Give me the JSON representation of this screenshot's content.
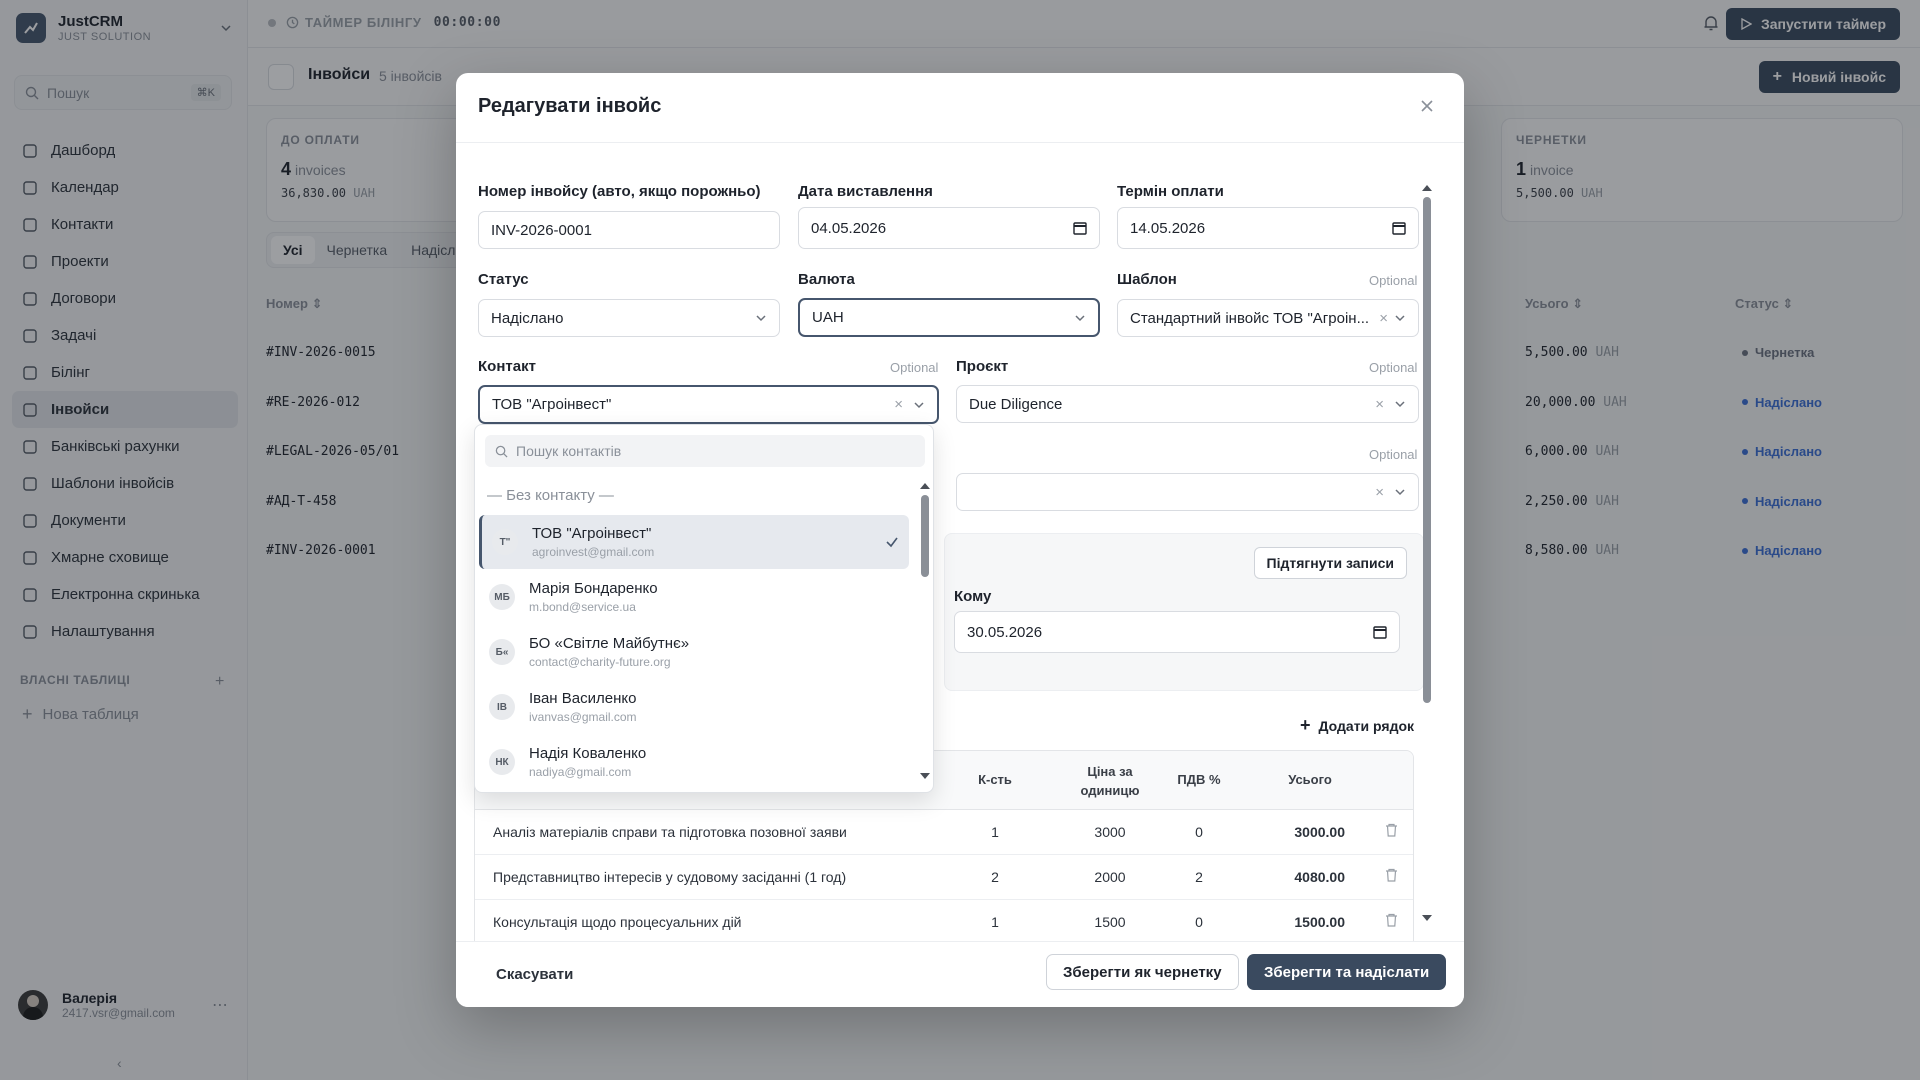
{
  "brand": {
    "name": "JustCRM",
    "sub": "JUST SOLUTION"
  },
  "search": {
    "placeholder": "Пошук",
    "shortcut": "⌘K"
  },
  "nav": [
    "Дашборд",
    "Календар",
    "Контакти",
    "Проекти",
    "Договори",
    "Задачі",
    "Білінг",
    "Інвойси",
    "Банківські рахунки",
    "Шаблони інвойсів",
    "Документи",
    "Хмарне сховище",
    "Електронна скринька",
    "Налаштування"
  ],
  "nav_icons": [
    "grid-icon",
    "calendar-icon",
    "users-icon",
    "briefcase-icon",
    "file-icon",
    "checklist-icon",
    "clock-icon",
    "invoice-icon",
    "bank-icon",
    "template-icon",
    "document-icon",
    "cloud-icon",
    "mail-icon",
    "gear-icon"
  ],
  "custom_tables": {
    "title": "ВЛАСНІ ТАБЛИЦІ",
    "new": "Нова таблиця"
  },
  "user": {
    "name": "Валерія",
    "email": "2417.vsr@gmail.com"
  },
  "topbar": {
    "timer_label": "ТАЙМЕР БІЛІНГУ",
    "timer_value": "00:00:00",
    "start": "Запустити таймер"
  },
  "page": {
    "title": "Інвойси",
    "count": "5 інвойсів",
    "new_button": "Новий інвойс"
  },
  "cards": [
    {
      "label": "ДО ОПЛАТИ",
      "count": "4",
      "unit": "invoices",
      "amount": "36,830.00",
      "currency": "UAH"
    },
    {
      "label": "ЧЕРНЕТКИ",
      "count": "1",
      "unit": "invoice",
      "amount": "5,500.00",
      "currency": "UAH"
    }
  ],
  "filters": [
    "Усі",
    "Чернетка",
    "Надісл"
  ],
  "table": {
    "col_number": "Номер",
    "col_total": "Усього",
    "col_status": "Статус",
    "rows": [
      {
        "number": "#INV-2026-0015",
        "total": "5,500.00",
        "currency": "UAH",
        "status": "Чернетка",
        "color": "#6b7280"
      },
      {
        "number": "#RE-2026-012",
        "total": "20,000.00",
        "currency": "UAH",
        "status": "Надіслано",
        "color": "#3b6fd6"
      },
      {
        "number": "#LEGAL-2026-05/01",
        "total": "6,000.00",
        "currency": "UAH",
        "status": "Надіслано",
        "color": "#3b6fd6"
      },
      {
        "number": "#АД-Т-458",
        "total": "2,250.00",
        "currency": "UAH",
        "status": "Надіслано",
        "color": "#3b6fd6"
      },
      {
        "number": "#INV-2026-0001",
        "total": "8,580.00",
        "currency": "UAH",
        "status": "Надіслано",
        "color": "#3b6fd6"
      }
    ]
  },
  "modal": {
    "title": "Редагувати інвойс",
    "invoice_number": {
      "label": "Номер інвойсу (авто, якщо порожньо)",
      "value": "INV-2026-0001"
    },
    "issue_date": {
      "label": "Дата виставлення",
      "value": "04.05.2026"
    },
    "due_date": {
      "label": "Термін оплати",
      "value": "14.05.2026"
    },
    "status": {
      "label": "Статус",
      "value": "Надіслано"
    },
    "currency": {
      "label": "Валюта",
      "value": "UAH"
    },
    "template": {
      "label": "Шаблон",
      "optional": "Optional",
      "value": "Стандартний інвойс ТОВ \"Агроін..."
    },
    "contact": {
      "label": "Контакт",
      "optional": "Optional",
      "value": "ТОВ \"Агроінвест\""
    },
    "project": {
      "label": "Проєкт",
      "optional": "Optional",
      "value": "Due Diligence"
    },
    "third_optional": "Optional",
    "period": {
      "pull_button": "Підтягнути записи",
      "to_label": "Кому",
      "to_value": "30.05.2026"
    },
    "add_row": "Додати рядок",
    "items_head": {
      "qty": "К-сть",
      "price": "Ціна за одиницю",
      "vat": "ПДВ %",
      "total": "Усього"
    },
    "items": [
      {
        "desc": "Аналіз матеріалів справи та підготовка позовної заяви",
        "qty": "1",
        "price": "3000",
        "vat": "0",
        "total": "3000.00"
      },
      {
        "desc": "Представництво інтересів у судовому засіданні (1 год)",
        "qty": "2",
        "price": "2000",
        "vat": "2",
        "total": "4080.00"
      },
      {
        "desc": "Консультація щодо процесуальних дій",
        "qty": "1",
        "price": "1500",
        "vat": "0",
        "total": "1500.00"
      }
    ],
    "cancel": "Скасувати",
    "save_draft": "Зберегти як чернетку",
    "save_send": "Зберегти та надіслати"
  },
  "dropdown": {
    "search_placeholder": "Пошук контактів",
    "none": "— Без контакту —",
    "items": [
      {
        "initials": "Т\"",
        "name": "ТОВ \"Агроінвест\"",
        "email": "agroinvest@gmail.com",
        "selected": true
      },
      {
        "initials": "МБ",
        "name": "Марія Бондаренко",
        "email": "m.bond@service.ua"
      },
      {
        "initials": "Б«",
        "name": "БО «Світле Майбутнє»",
        "email": "contact@charity-future.org"
      },
      {
        "initials": "ІВ",
        "name": "Іван Василенко",
        "email": "ivanvas@gmail.com"
      },
      {
        "initials": "НК",
        "name": "Надія Коваленко",
        "email": "nadiya@gmail.com"
      }
    ]
  }
}
